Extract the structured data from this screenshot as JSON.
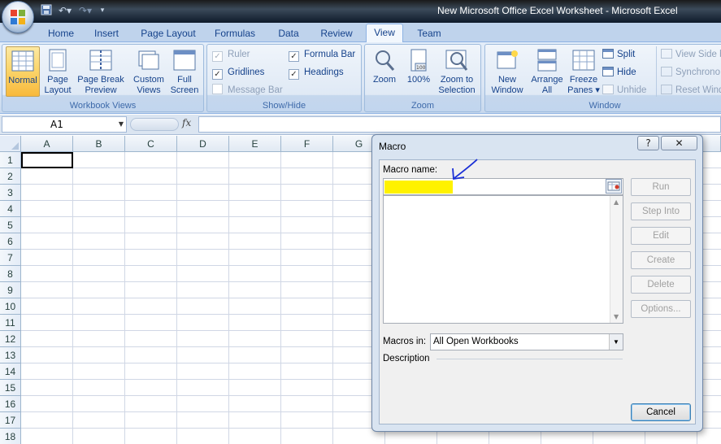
{
  "window": {
    "title": "New Microsoft Office Excel Worksheet - Microsoft Excel"
  },
  "ribbon_tabs": [
    "Home",
    "Insert",
    "Page Layout",
    "Formulas",
    "Data",
    "Review",
    "View",
    "Team"
  ],
  "active_tab": "View",
  "groups": {
    "workbook_views": {
      "label": "Workbook Views",
      "buttons": [
        "Normal",
        "Page\nLayout",
        "Page Break\nPreview",
        "Custom\nViews",
        "Full\nScreen"
      ]
    },
    "show_hide": {
      "label": "Show/Hide",
      "ruler": "Ruler",
      "gridlines": "Gridlines",
      "message_bar": "Message Bar",
      "formula_bar": "Formula Bar",
      "headings": "Headings"
    },
    "zoom": {
      "label": "Zoom",
      "buttons": [
        "Zoom",
        "100%",
        "Zoom to\nSelection"
      ]
    },
    "window": {
      "label": "Window",
      "buttons": [
        "New\nWindow",
        "Arrange\nAll",
        "Freeze\nPanes ▾"
      ],
      "split": "Split",
      "hide": "Hide",
      "unhide": "Unhide",
      "view_side": "View Side b",
      "synchronous": "Synchrono",
      "reset_window": "Reset Wind"
    }
  },
  "formula_bar": {
    "name_box": "A1",
    "fx": "fx",
    "value": ""
  },
  "grid": {
    "columns": [
      "A",
      "B",
      "C",
      "D",
      "E",
      "F",
      "G"
    ],
    "rows": [
      "1",
      "2",
      "3",
      "4",
      "5",
      "6",
      "7",
      "8",
      "9",
      "10",
      "11",
      "12",
      "13",
      "14",
      "15",
      "16",
      "17",
      "18"
    ]
  },
  "macro_dialog": {
    "title": "Macro",
    "help": "?",
    "close": "✕",
    "macro_name_label": "Macro name:",
    "macro_name_value": "",
    "buttons": [
      "Run",
      "Step Into",
      "Edit",
      "Create",
      "Delete",
      "Options..."
    ],
    "macros_in_label": "Macros in:",
    "macros_in_value": "All Open Workbooks",
    "description_label": "Description",
    "cancel": "Cancel"
  },
  "colors": {
    "annotation_highlight": "#fff200",
    "annotation_arrow": "#1a2fd6",
    "selected_button": "#fbd66d"
  }
}
